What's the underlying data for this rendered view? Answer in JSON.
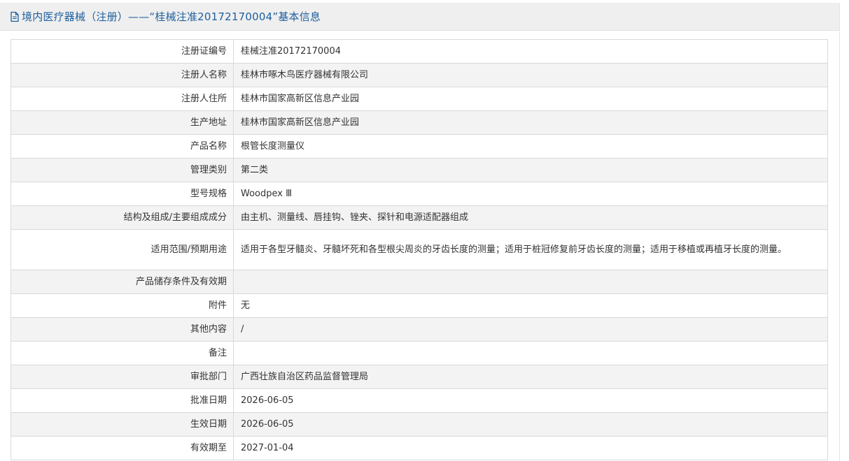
{
  "header": {
    "icon": "document-icon",
    "title": "境内医疗器械（注册）——“桂械注准20172170004”基本信息"
  },
  "rows": [
    {
      "label": "注册证编号",
      "value": "桂械注准20172170004"
    },
    {
      "label": "注册人名称",
      "value": "桂林市啄木鸟医疗器械有限公司"
    },
    {
      "label": "注册人住所",
      "value": "桂林市国家高新区信息产业园"
    },
    {
      "label": "生产地址",
      "value": "桂林市国家高新区信息产业园"
    },
    {
      "label": "产品名称",
      "value": "根管长度测量仪"
    },
    {
      "label": "管理类别",
      "value": "第二类"
    },
    {
      "label": "型号规格",
      "value": "Woodpex Ⅲ"
    },
    {
      "label": "结构及组成/主要组成成分",
      "value": "由主机、测量线、唇挂钩、锉夹、探针和电源适配器组成"
    },
    {
      "label": "适用范围/预期用途",
      "value": "适用于各型牙髓炎、牙髓坏死和各型根尖周炎的牙齿长度的测量；适用于桩冠修复前牙齿长度的测量；适用于移植或再植牙长度的测量。"
    },
    {
      "label": "产品储存条件及有效期",
      "value": ""
    },
    {
      "label": "附件",
      "value": "无"
    },
    {
      "label": "其他内容",
      "value": "/"
    },
    {
      "label": "备注",
      "value": ""
    },
    {
      "label": "审批部门",
      "value": "广西壮族自治区药品监督管理局"
    },
    {
      "label": "批准日期",
      "value": "2026-06-05"
    },
    {
      "label": "生效日期",
      "value": "2026-06-05"
    },
    {
      "label": "有效期至",
      "value": "2027-01-04"
    }
  ]
}
